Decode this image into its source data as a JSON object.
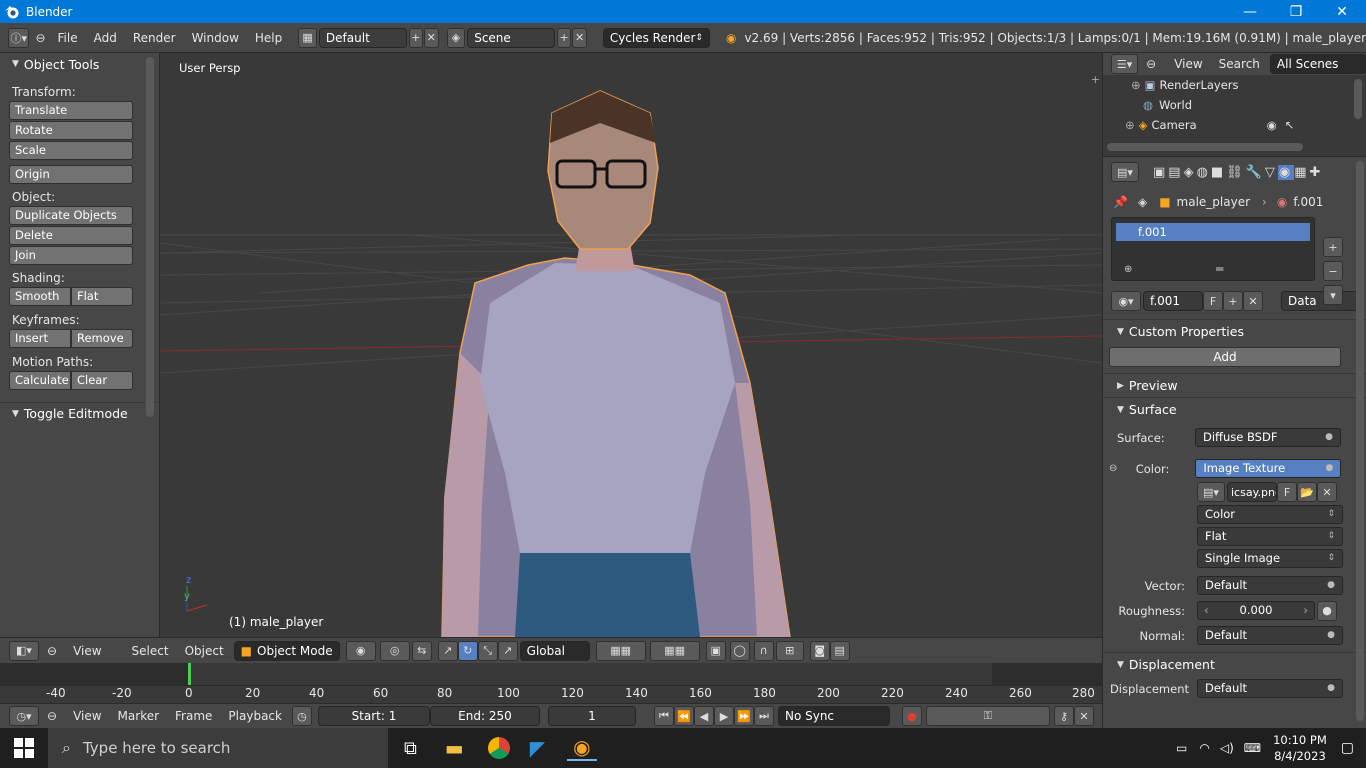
{
  "window": {
    "title": "Blender",
    "minimize": "—",
    "restore": "❐",
    "close": "✕"
  },
  "topbar": {
    "menus": [
      "File",
      "Add",
      "Render",
      "Window",
      "Help"
    ],
    "screen_layout": "Default",
    "scene": "Scene",
    "render_engine": "Cycles Render",
    "stats": "v2.69 | Verts:2856 | Faces:952 | Tris:952 | Objects:1/3 | Lamps:0/1 | Mem:19.16M (0.91M) | male_player"
  },
  "tools": {
    "header": "Object Tools",
    "transform_label": "Transform:",
    "translate": "Translate",
    "rotate": "Rotate",
    "scale": "Scale",
    "origin": "Origin",
    "object_label": "Object:",
    "duplicate": "Duplicate Objects",
    "delete": "Delete",
    "join": "Join",
    "shading_label": "Shading:",
    "smooth": "Smooth",
    "flat": "Flat",
    "keyframes_label": "Keyframes:",
    "insert": "Insert",
    "remove": "Remove",
    "motion_label": "Motion Paths:",
    "calculate": "Calculate",
    "clear": "Clear",
    "toggle_editmode": "Toggle Editmode"
  },
  "viewport": {
    "view_name": "User Persp",
    "object_name": "(1) male_player",
    "axis_z": "z",
    "axis_y": "y"
  },
  "viewbar": {
    "view": "View",
    "select": "Select",
    "object": "Object",
    "mode": "Object Mode",
    "orientation": "Global"
  },
  "timeline": {
    "ticks": [
      "-40",
      "-20",
      "0",
      "20",
      "40",
      "60",
      "80",
      "100",
      "120",
      "140",
      "160",
      "180",
      "200",
      "220",
      "240",
      "260",
      "280"
    ],
    "view": "View",
    "marker": "Marker",
    "frame": "Frame",
    "playback": "Playback",
    "start": "Start: 1",
    "end": "End: 250",
    "current": "1",
    "sync": "No Sync"
  },
  "outliner": {
    "view": "View",
    "search": "Search",
    "filter": "All Scenes",
    "items": [
      "RenderLayers",
      "World",
      "Camera"
    ]
  },
  "properties": {
    "breadcrumb_object": "male_player",
    "breadcrumb_material": "f.001",
    "slot": "f.001",
    "material_name": "f.001",
    "fake_user": "F",
    "link": "Data",
    "custom_properties": "Custom Properties",
    "add": "Add",
    "preview": "Preview",
    "surface_header": "Surface",
    "surface_label": "Surface:",
    "surface_value": "Diffuse BSDF",
    "color_label": "Color:",
    "color_value": "Image Texture",
    "image_name": "icsay.png",
    "image_f": "F",
    "color_space": "Color",
    "projection": "Flat",
    "source": "Single Image",
    "vector_label": "Vector:",
    "vector_value": "Default",
    "roughness_label": "Roughness:",
    "roughness_value": "0.000",
    "normal_label": "Normal:",
    "normal_value": "Default",
    "displacement_header": "Displacement",
    "displacement_label": "Displacement",
    "displacement_value": "Default"
  },
  "taskbar": {
    "search_placeholder": "Type here to search",
    "time": "10:10 PM",
    "date": "8/4/2023"
  }
}
